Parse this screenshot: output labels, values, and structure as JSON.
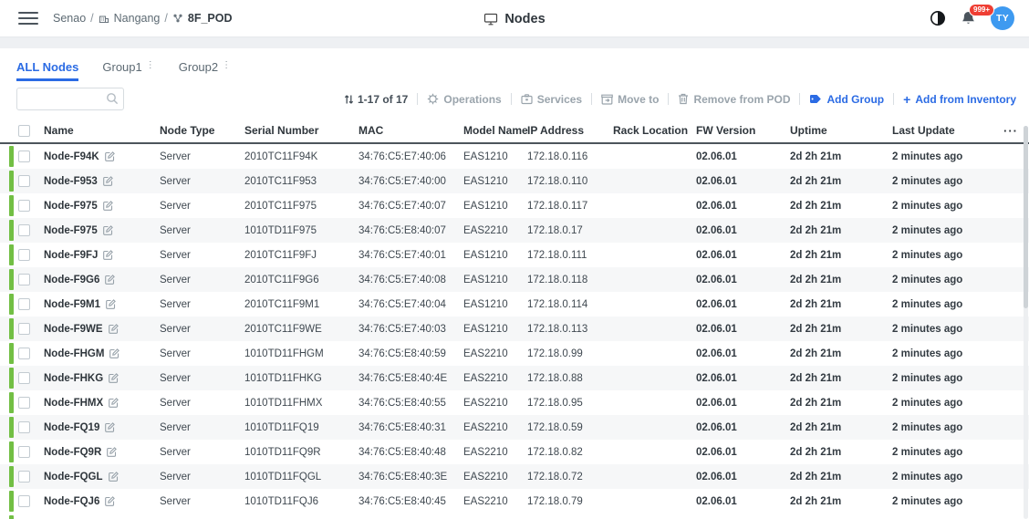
{
  "header": {
    "breadcrumb": {
      "site": "Senao",
      "separator": "/",
      "building": "Nangang",
      "pod": "8F_POD"
    },
    "title": "Nodes",
    "notifications_badge": "999+",
    "avatar_initials": "TY"
  },
  "tabs": [
    {
      "label": "ALL Nodes",
      "active": true
    },
    {
      "label": "Group1",
      "active": false
    },
    {
      "label": "Group2",
      "active": false
    }
  ],
  "toolbar": {
    "selection_count": "1-17 of 17",
    "operations": "Operations",
    "services": "Services",
    "move_to": "Move to",
    "remove_from_pod": "Remove from POD",
    "add_group": "Add Group",
    "add_from_inventory_prefix": "+",
    "add_from_inventory": "Add from Inventory"
  },
  "table": {
    "columns": [
      "Name",
      "Node Type",
      "Serial Number",
      "MAC",
      "Model Name",
      "IP Address",
      "Rack Location",
      "FW Version",
      "Uptime",
      "Last Update"
    ],
    "more_columns": "···",
    "rows": [
      {
        "name": "Node-F94K",
        "node_type": "Server",
        "serial_number": "2010TC11F94K",
        "mac": "34:76:C5:E7:40:06",
        "model_name": "EAS1210",
        "ip_address": "172.18.0.116",
        "rack_location": "",
        "fw_version": "02.06.01",
        "uptime": "2d 2h 21m",
        "last_update": "2 minutes ago"
      },
      {
        "name": "Node-F953",
        "node_type": "Server",
        "serial_number": "2010TC11F953",
        "mac": "34:76:C5:E7:40:00",
        "model_name": "EAS1210",
        "ip_address": "172.18.0.110",
        "rack_location": "",
        "fw_version": "02.06.01",
        "uptime": "2d 2h 21m",
        "last_update": "2 minutes ago"
      },
      {
        "name": "Node-F975",
        "node_type": "Server",
        "serial_number": "2010TC11F975",
        "mac": "34:76:C5:E7:40:07",
        "model_name": "EAS1210",
        "ip_address": "172.18.0.117",
        "rack_location": "",
        "fw_version": "02.06.01",
        "uptime": "2d 2h 21m",
        "last_update": "2 minutes ago"
      },
      {
        "name": "Node-F975",
        "node_type": "Server",
        "serial_number": "1010TD11F975",
        "mac": "34:76:C5:E8:40:07",
        "model_name": "EAS2210",
        "ip_address": "172.18.0.17",
        "rack_location": "",
        "fw_version": "02.06.01",
        "uptime": "2d 2h 21m",
        "last_update": "2 minutes ago"
      },
      {
        "name": "Node-F9FJ",
        "node_type": "Server",
        "serial_number": "2010TC11F9FJ",
        "mac": "34:76:C5:E7:40:01",
        "model_name": "EAS1210",
        "ip_address": "172.18.0.111",
        "rack_location": "",
        "fw_version": "02.06.01",
        "uptime": "2d 2h 21m",
        "last_update": "2 minutes ago"
      },
      {
        "name": "Node-F9G6",
        "node_type": "Server",
        "serial_number": "2010TC11F9G6",
        "mac": "34:76:C5:E7:40:08",
        "model_name": "EAS1210",
        "ip_address": "172.18.0.118",
        "rack_location": "",
        "fw_version": "02.06.01",
        "uptime": "2d 2h 21m",
        "last_update": "2 minutes ago"
      },
      {
        "name": "Node-F9M1",
        "node_type": "Server",
        "serial_number": "2010TC11F9M1",
        "mac": "34:76:C5:E7:40:04",
        "model_name": "EAS1210",
        "ip_address": "172.18.0.114",
        "rack_location": "",
        "fw_version": "02.06.01",
        "uptime": "2d 2h 21m",
        "last_update": "2 minutes ago"
      },
      {
        "name": "Node-F9WE",
        "node_type": "Server",
        "serial_number": "2010TC11F9WE",
        "mac": "34:76:C5:E7:40:03",
        "model_name": "EAS1210",
        "ip_address": "172.18.0.113",
        "rack_location": "",
        "fw_version": "02.06.01",
        "uptime": "2d 2h 21m",
        "last_update": "2 minutes ago"
      },
      {
        "name": "Node-FHGM",
        "node_type": "Server",
        "serial_number": "1010TD11FHGM",
        "mac": "34:76:C5:E8:40:59",
        "model_name": "EAS2210",
        "ip_address": "172.18.0.99",
        "rack_location": "",
        "fw_version": "02.06.01",
        "uptime": "2d 2h 21m",
        "last_update": "2 minutes ago"
      },
      {
        "name": "Node-FHKG",
        "node_type": "Server",
        "serial_number": "1010TD11FHKG",
        "mac": "34:76:C5:E8:40:4E",
        "model_name": "EAS2210",
        "ip_address": "172.18.0.88",
        "rack_location": "",
        "fw_version": "02.06.01",
        "uptime": "2d 2h 21m",
        "last_update": "2 minutes ago"
      },
      {
        "name": "Node-FHMX",
        "node_type": "Server",
        "serial_number": "1010TD11FHMX",
        "mac": "34:76:C5:E8:40:55",
        "model_name": "EAS2210",
        "ip_address": "172.18.0.95",
        "rack_location": "",
        "fw_version": "02.06.01",
        "uptime": "2d 2h 21m",
        "last_update": "2 minutes ago"
      },
      {
        "name": "Node-FQ19",
        "node_type": "Server",
        "serial_number": "1010TD11FQ19",
        "mac": "34:76:C5:E8:40:31",
        "model_name": "EAS2210",
        "ip_address": "172.18.0.59",
        "rack_location": "",
        "fw_version": "02.06.01",
        "uptime": "2d 2h 21m",
        "last_update": "2 minutes ago"
      },
      {
        "name": "Node-FQ9R",
        "node_type": "Server",
        "serial_number": "1010TD11FQ9R",
        "mac": "34:76:C5:E8:40:48",
        "model_name": "EAS2210",
        "ip_address": "172.18.0.82",
        "rack_location": "",
        "fw_version": "02.06.01",
        "uptime": "2d 2h 21m",
        "last_update": "2 minutes ago"
      },
      {
        "name": "Node-FQGL",
        "node_type": "Server",
        "serial_number": "1010TD11FQGL",
        "mac": "34:76:C5:E8:40:3E",
        "model_name": "EAS2210",
        "ip_address": "172.18.0.72",
        "rack_location": "",
        "fw_version": "02.06.01",
        "uptime": "2d 2h 21m",
        "last_update": "2 minutes ago"
      },
      {
        "name": "Node-FQJ6",
        "node_type": "Server",
        "serial_number": "1010TD11FQJ6",
        "mac": "34:76:C5:E8:40:45",
        "model_name": "EAS2210",
        "ip_address": "172.18.0.79",
        "rack_location": "",
        "fw_version": "02.06.01",
        "uptime": "2d 2h 21m",
        "last_update": "2 minutes ago"
      }
    ]
  },
  "colors": {
    "accent_blue": "#2b6be4",
    "status_green": "#72bf44",
    "badge_red": "#ef3e33",
    "avatar_blue": "#3e9af0"
  }
}
